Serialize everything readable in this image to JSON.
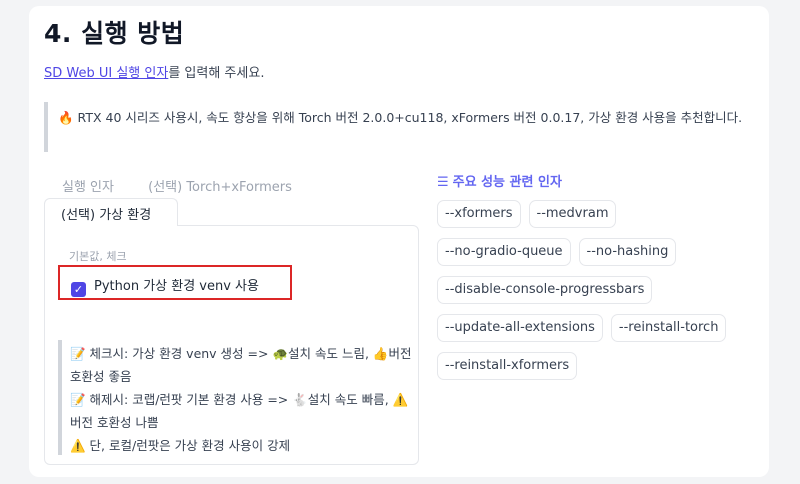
{
  "section": {
    "title": "4. 실행 방법",
    "intro_link": "SD Web UI 실행 인자",
    "intro_rest": "를 입력해 주세요."
  },
  "notice": {
    "icon": "fire-icon",
    "text": "🔥 RTX 40 시리즈 사용시, 속도 향상을 위해 Torch 버전 2.0.0+cu118, xFormers 버전 0.0.17, 가상 환경 사용을 추천합니다."
  },
  "tabs": [
    {
      "label": "실행 인자"
    },
    {
      "label": "(선택) Torch+xFormers"
    },
    {
      "label": "(선택) 가상 환경"
    }
  ],
  "panel": {
    "default_label": "기본값, 체크",
    "venv_checkbox": {
      "checked": true,
      "label": "Python 가상 환경 venv 사용"
    },
    "notes": [
      "📝 체크시: 가상 환경 venv 생성 => 🐢설치 속도 느림, 👍버전 호환성 좋음",
      "📝 해제시: 코랩/런팟 기본 환경 사용 => 🐇설치 속도 빠름, ⚠️버전 호환성 나쁨",
      "⚠️ 단, 로컬/런팟은 가상 환경 사용이 강제"
    ]
  },
  "performance": {
    "icon": "list-icon",
    "title": "주요 성능 관련 인자",
    "chips": [
      [
        "--xformers",
        "--medvram"
      ],
      [
        "--no-gradio-queue",
        "--no-hashing"
      ],
      [
        "--disable-console-progressbars"
      ],
      [
        "--update-all-extensions",
        "--reinstall-torch"
      ],
      [
        "--reinstall-xformers"
      ]
    ]
  },
  "colors": {
    "accent": "#4f46e5",
    "highlight_border": "#dc2626"
  }
}
